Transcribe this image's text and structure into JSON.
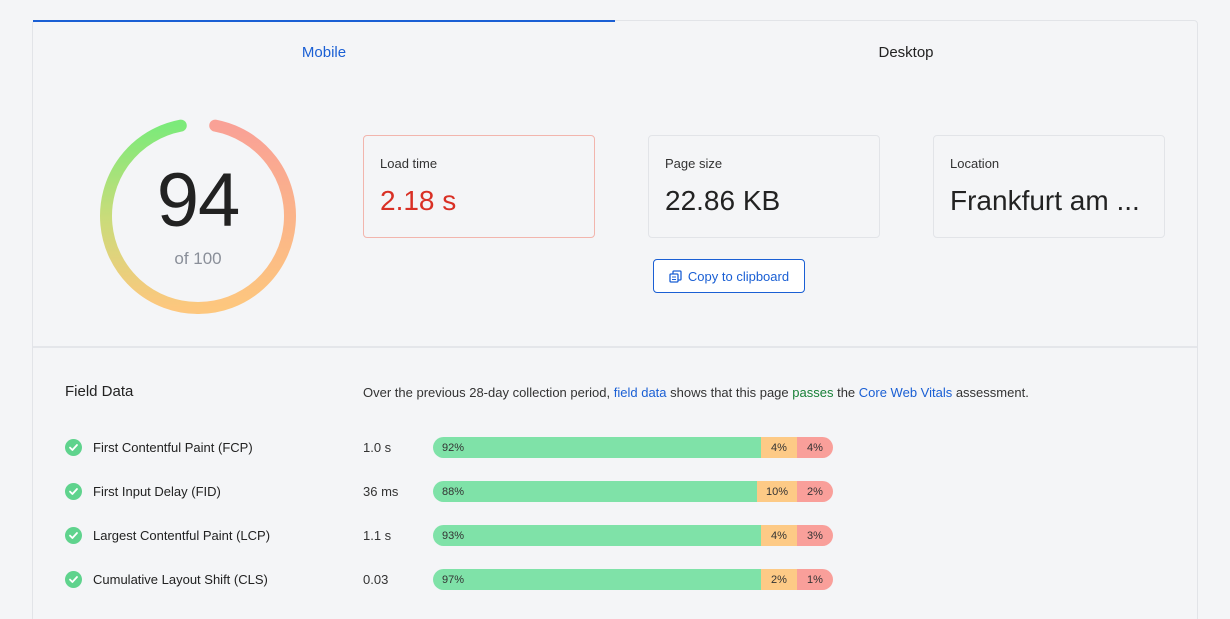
{
  "tabs": [
    {
      "label": "Mobile",
      "active": true
    },
    {
      "label": "Desktop",
      "active": false
    }
  ],
  "score": {
    "value": "94",
    "of_label": "of 100",
    "fraction": 0.94
  },
  "metrics": {
    "load_time": {
      "label": "Load time",
      "value": "2.18 s"
    },
    "page_size": {
      "label": "Page size",
      "value": "22.86 KB"
    },
    "location": {
      "label": "Location",
      "value": "Frankfurt am ..."
    }
  },
  "copy_button": {
    "label": "Copy to clipboard"
  },
  "field_data": {
    "title": "Field Data",
    "description": {
      "part1": "Over the previous 28-day collection period, ",
      "link1": "field data",
      "part2": " shows that this page ",
      "status": "passes",
      "part3": " the ",
      "link2": "Core Web Vitals",
      "part4": " assessment."
    },
    "rows": [
      {
        "name": "First Contentful Paint (FCP)",
        "value": "1.0 s",
        "good": 92,
        "average": 4,
        "poor": 4,
        "good_label": "92%",
        "average_label": "4%",
        "poor_label": "4%"
      },
      {
        "name": "First Input Delay (FID)",
        "value": "36 ms",
        "good": 88,
        "average": 10,
        "poor": 2,
        "good_label": "88%",
        "average_label": "10%",
        "poor_label": "2%"
      },
      {
        "name": "Largest Contentful Paint (LCP)",
        "value": "1.1 s",
        "good": 93,
        "average": 4,
        "poor": 3,
        "good_label": "93%",
        "average_label": "4%",
        "poor_label": "3%"
      },
      {
        "name": "Cumulative Layout Shift (CLS)",
        "value": "0.03",
        "good": 97,
        "average": 2,
        "poor": 1,
        "good_label": "97%",
        "average_label": "2%",
        "poor_label": "1%"
      }
    ]
  },
  "colors": {
    "accent": "#1a5fd4",
    "good": "#7fe2a8",
    "average": "#fdca86",
    "poor": "#f99f9a",
    "error": "#d93025"
  }
}
